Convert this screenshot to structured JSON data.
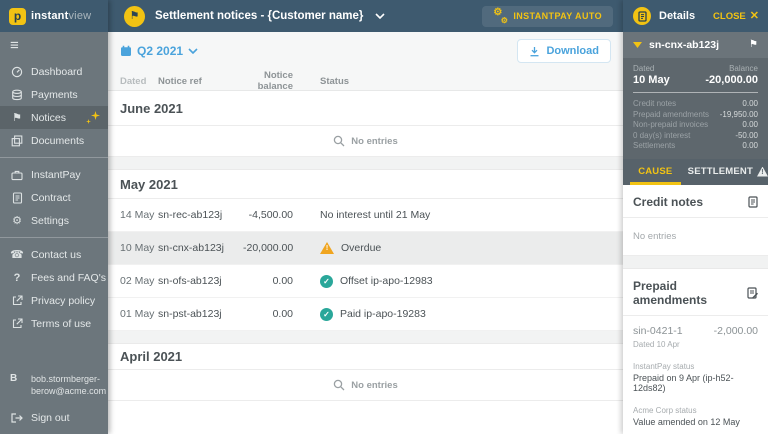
{
  "colors": {
    "header_bg": "#3e5a6f",
    "sidebar_bg": "#6c767c",
    "accent_yellow": "#f2c313",
    "link_blue": "#4aa3dc",
    "success_teal": "#2aa79a",
    "warning_orange": "#f0a51f",
    "panel_gray": "#6b747a",
    "panel_card": "#5e676d",
    "tabbar_bg": "#57626a",
    "selected_row": "#ebecec"
  },
  "logo": {
    "mark": "p",
    "brand_bold": "instant",
    "brand_light": "view"
  },
  "sidebar": {
    "items": [
      {
        "label": "Dashboard",
        "icon": "dashboard-icon"
      },
      {
        "label": "Payments",
        "icon": "coins-icon"
      },
      {
        "label": "Notices",
        "icon": "flag-icon",
        "active": true,
        "badge": "sparkles-icon"
      },
      {
        "label": "Documents",
        "icon": "copy-icon"
      },
      {
        "label": "InstantPay",
        "icon": "briefcase-icon"
      },
      {
        "label": "Contract",
        "icon": "document-icon"
      },
      {
        "label": "Settings",
        "icon": "gears-icon"
      },
      {
        "label": "Contact us",
        "icon": "phone-icon"
      },
      {
        "label": "Fees and FAQ's",
        "icon": "question-icon"
      },
      {
        "label": "Privacy policy",
        "icon": "external-link-icon"
      },
      {
        "label": "Terms of use",
        "icon": "external-link-icon"
      }
    ],
    "user_initial": "B",
    "user_email_line1": "bob.stormberger-",
    "user_email_line2": "berow@acme.com",
    "sign_out": "Sign out"
  },
  "header": {
    "title": "Settlement notices - {Customer name}",
    "instantpay_auto_label": "INSTANTPAY AUTO"
  },
  "toolbar": {
    "period": "Q2 2021",
    "download_label": "Download"
  },
  "table": {
    "columns": [
      "Dated",
      "Notice ref",
      "Notice balance",
      "Status"
    ],
    "sections": [
      {
        "title": "June 2021",
        "empty": "No entries"
      },
      {
        "title": "May 2021",
        "rows": [
          {
            "dated": "14 May",
            "ref": "sn-rec-ab123j",
            "balance": "-4,500.00",
            "status": "No interest until 21 May",
            "status_icon": "none"
          },
          {
            "dated": "10 May",
            "ref": "sn-cnx-ab123j",
            "balance": "-20,000.00",
            "status": "Overdue",
            "status_icon": "warning",
            "selected": true
          },
          {
            "dated": "02 May",
            "ref": "sn-ofs-ab123j",
            "balance": "0.00",
            "status": "Offset ip-apo-12983",
            "status_icon": "check"
          },
          {
            "dated": "01 May",
            "ref": "sn-pst-ab123j",
            "balance": "0.00",
            "status": "Paid ip-apo-19283",
            "status_icon": "check"
          }
        ]
      },
      {
        "title": "April 2021",
        "empty": "No entries"
      }
    ]
  },
  "details": {
    "title": "Details",
    "close_label": "CLOSE",
    "notice_ref": "sn-cnx-ab123j",
    "dated_label": "Dated",
    "dated_value": "10 May",
    "balance_label": "Balance",
    "balance_value": "-20,000.00",
    "breakdown": [
      {
        "label": "Credit notes",
        "value": "0.00"
      },
      {
        "label": "Prepaid amendments",
        "value": "-19,950.00"
      },
      {
        "label": "Non-prepaid invoices",
        "value": "0.00"
      },
      {
        "label": "0 day(s) interest",
        "value": "-50.00"
      },
      {
        "label": "Settlements",
        "value": "0.00"
      }
    ],
    "tabs": [
      {
        "label": "CAUSE",
        "active": true
      },
      {
        "label": "SETTLEMENT",
        "warning": true
      }
    ],
    "credit_notes_title": "Credit notes",
    "credit_notes_empty": "No entries",
    "prepaid_title": "Prepaid amendments",
    "amendment": {
      "ref": "sin-0421-1",
      "amount": "-2,000.00",
      "dated": "Dated 10 Apr",
      "instantpay_status_label": "InstantPay status",
      "instantpay_status_value": "Prepaid on 9 Apr (ip-h52-12ds82)",
      "acme_status_label": "Acme Corp status",
      "acme_status_value": "Value amended on 12 May"
    }
  }
}
